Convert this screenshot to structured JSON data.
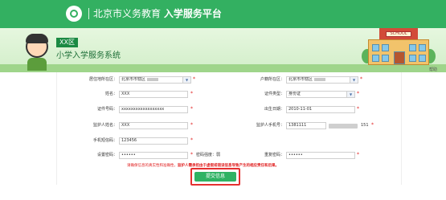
{
  "header": {
    "title_prefix": "北京市义务教育",
    "title_main": "入学服务平台",
    "logo_icon": "beijing-edu-logo-icon",
    "bg_color": "#33b061"
  },
  "banner": {
    "area_badge": "XX区",
    "system_title": "小学入学服务系统",
    "school_sign": "SCHOOL",
    "help_label": "帮助"
  },
  "form": {
    "residence_district": {
      "label": "居住地所在区：",
      "value": "北京市市辖区"
    },
    "household_district": {
      "label": "户籍所在区：",
      "value": "北京市市辖区"
    },
    "name": {
      "label": "姓名：",
      "value": "XXX"
    },
    "id_type": {
      "label": "证件类型：",
      "value": "身份证"
    },
    "id_number": {
      "label": "证件号码：",
      "value": "xxxxxxxxxxxxxxxxxx"
    },
    "birth_date": {
      "label": "出生日期：",
      "value": "2010-11-01"
    },
    "guardian_name": {
      "label": "监护人姓名：",
      "value": "XXX"
    },
    "guardian_phone": {
      "label": "监护人手机号：",
      "value": "1381111",
      "suffix": "151"
    },
    "sms_code": {
      "label": "手机短信码：",
      "value": "123456"
    },
    "password": {
      "label": "设置密码：",
      "value": "••••••",
      "strength": "密码强度：弱"
    },
    "confirm_password": {
      "label": "重复密码：",
      "value": "••••••"
    }
  },
  "notice": {
    "text_a": "请确保信息的真实性和准确性，",
    "text_b": "监护人需承担由于虚假或错误信息导致产生的相应责任和后果。"
  },
  "submit": {
    "label": "提交信息"
  }
}
